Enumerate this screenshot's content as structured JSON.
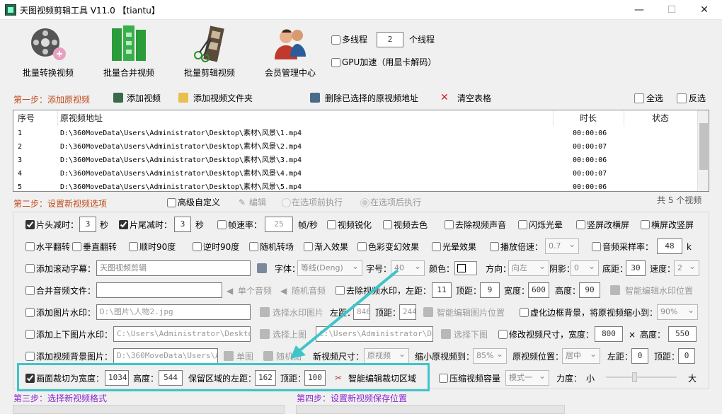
{
  "window": {
    "title": "天图视频剪辑工具 V11.0  【tiantu】",
    "min": "—",
    "max": "☐",
    "close": "✕"
  },
  "toolbar": {
    "items": [
      {
        "label": "批量转换视频",
        "icon": "film-reel-icon"
      },
      {
        "label": "批量合并视频",
        "icon": "green-blocks-icon"
      },
      {
        "label": "批量剪辑视频",
        "icon": "scissors-film-icon"
      },
      {
        "label": "会员管理中心",
        "icon": "users-icon"
      }
    ],
    "multithread_label": "多线程",
    "thread_count": "2",
    "thread_unit": "个线程",
    "gpu_label": "GPU加速（用显卡解码）"
  },
  "step1": {
    "title": "第一步：添加原视频",
    "add_video": "添加视频",
    "add_folder": "添加视频文件夹",
    "delete_selected": "删除已选择的原视频地址",
    "clear_table": "清空表格",
    "select_all": "全选",
    "invert": "反选",
    "columns": [
      "序号",
      "原视频地址",
      "时长",
      "状态"
    ],
    "rows": [
      {
        "no": "1",
        "path": "D:\\360MoveData\\Users\\Administrator\\Desktop\\素材\\风景\\1.mp4",
        "dur": "00:00:06",
        "status": ""
      },
      {
        "no": "2",
        "path": "D:\\360MoveData\\Users\\Administrator\\Desktop\\素材\\风景\\2.mp4",
        "dur": "00:00:07",
        "status": ""
      },
      {
        "no": "3",
        "path": "D:\\360MoveData\\Users\\Administrator\\Desktop\\素材\\风景\\3.mp4",
        "dur": "00:00:06",
        "status": ""
      },
      {
        "no": "4",
        "path": "D:\\360MoveData\\Users\\Administrator\\Desktop\\素材\\风景\\4.mp4",
        "dur": "00:00:07",
        "status": ""
      },
      {
        "no": "5",
        "path": "D:\\360MoveData\\Users\\Administrator\\Desktop\\素材\\风景\\5.mp4",
        "dur": "00:00:06",
        "status": ""
      }
    ],
    "total": "共 5 个视频"
  },
  "step2": {
    "title": "第二步：设置新视频选项",
    "advanced": "高级自定义",
    "edit": "编辑",
    "before": "在选项前执行",
    "after": "在选项后执行",
    "r1": {
      "head_cut": "片头减时：",
      "head_val": "3",
      "sec1": "秒",
      "tail_cut": "片尾减时：",
      "tail_val": "3",
      "sec2": "秒",
      "fps": "帧速率：",
      "fps_val": "25",
      "fps_unit": "帧/秒",
      "sharpen": "视频锐化",
      "decolor": "视频去色",
      "mute": "去除视频声音",
      "flash": "闪烁光晕",
      "v2h": "竖屏改横屏",
      "h2v": "横屏改竖屏"
    },
    "r2": {
      "hflip": "水平翻转",
      "vflip": "垂直翻转",
      "rot90cw": "顺时90度",
      "rot90ccw": "逆时90度",
      "trans": "随机转场",
      "fade": "渐入效果",
      "color": "色彩变幻效果",
      "light": "光晕效果",
      "speed": "播放倍速：",
      "speed_val": "0.7",
      "samplerate": "音频采样率：",
      "sr_val": "48",
      "sr_unit": "k"
    },
    "r3": {
      "scroll": "添加滚动字幕：",
      "scroll_text": "天图视频剪辑",
      "font": "字体：",
      "font_val": "等线(Deng)",
      "size": "字号：",
      "size_val": "40",
      "color": "颜色：",
      "dir": "方向：",
      "dir_val": "向左",
      "shadow": "阴影：",
      "shadow_val": "0",
      "bottom": "底距：",
      "bottom_val": "30",
      "spd": "速度：",
      "spd_val": "2"
    },
    "r4": {
      "merge_audio": "合并音频文件：",
      "single_audio": "单个音频",
      "random_audio": "随机音频",
      "remove_wm": "去除视频水印，左距：",
      "left_val": "11",
      "top": "顶距：",
      "top_val": "9",
      "width": "宽度：",
      "width_val": "600",
      "height": "高度：",
      "height_val": "90",
      "smart_wm": "智能编辑水印位置"
    },
    "r5": {
      "img_wm": "添加图片水印：",
      "img_path": "D:\\图片\\人物2.jpg",
      "choose_img": "选择水印图片",
      "left": "左距：",
      "left_val": "846",
      "top": "顶距：",
      "top_val": "244",
      "smart_img": "智能编辑图片位置",
      "blur": "虚化边框背景，将原视频缩小到：",
      "blur_val": "90%"
    },
    "r6": {
      "tb_wm": "添加上下图片水印：",
      "top_path": "C:\\Users\\Administrator\\Desktop\\素",
      "choose_top": "选择上图",
      "bottom_path": "C:\\Users\\Administrator\\Desk",
      "choose_bottom": "选择下图",
      "resize": "修改视频尺寸，宽度：",
      "w_val": "800",
      "x": "×",
      "h": "高度：",
      "h_val": "550"
    },
    "r7": {
      "bg": "添加视频背景图片：",
      "bg_path": "D:\\360MoveData\\Users\\Adm",
      "single": "单图",
      "random": "随机图",
      "newsize": "新视频尺寸：",
      "newsize_val": "原视频",
      "shrink": "缩小原视频到：",
      "shrink_val": "85%",
      "pos": "原视频位置：",
      "pos_val": "居中",
      "left": "左距：",
      "left_val": "0",
      "top": "顶距：",
      "top_val": "0"
    },
    "r8": {
      "crop": "画面裁切为宽度：",
      "crop_w": "1034",
      "height": "高度：",
      "crop_h": "544",
      "keep_left": "保留区域的左距：",
      "keep_left_val": "162",
      "top": "顶距：",
      "top_val": "100",
      "smart_crop": "智能编辑裁切区域",
      "compress": "压缩视频容量",
      "mode_val": "模式一",
      "strength": "力度：",
      "small": "小",
      "large": "大",
      "strength_level": 0.4
    }
  },
  "step3": {
    "title": "第三步：选择新视频格式"
  },
  "step4": {
    "title": "第四步：设置新视频保存位置"
  },
  "colors": {
    "step_orange": "#c04a1a",
    "step_purple": "#8a2ad0",
    "highlight": "#3fc4c8"
  }
}
